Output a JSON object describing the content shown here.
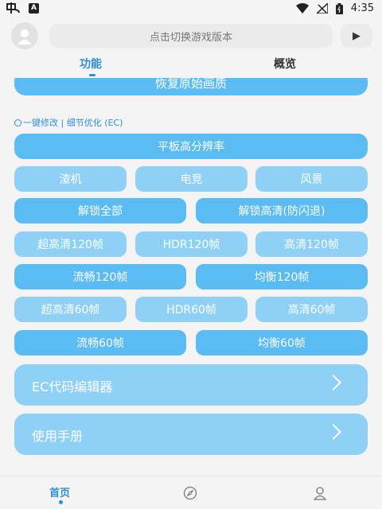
{
  "status": {
    "time": "4:35"
  },
  "header": {
    "search_text": "点击切换游戏版本"
  },
  "tabs": [
    {
      "label": "功能"
    },
    {
      "label": "概览"
    }
  ],
  "top_partial_button": "恢复原始画质",
  "section": {
    "label": "一键修改 | 细节优化 (EC)"
  },
  "buttons": {
    "tablet_resolution": "平板高分辨率",
    "low_end": "渣机",
    "esports": "电竞",
    "scenery": "风景",
    "unlock_all": "解锁全部",
    "unlock_hd": "解锁高清(防闪退)",
    "uhd_120": "超高清120帧",
    "hdr_120": "HDR120帧",
    "hd_120": "高清120帧",
    "smooth_120": "流畅120帧",
    "balanced_120": "均衡120帧",
    "uhd_60": "超高清60帧",
    "hdr_60": "HDR60帧",
    "hd_60": "高清60帧",
    "smooth_60": "流畅60帧",
    "balanced_60": "均衡60帧"
  },
  "cards": {
    "ec_editor": "EC代码编辑器",
    "manual": "使用手册"
  },
  "bottom_nav": {
    "home": "首页"
  },
  "colors": {
    "accent": "#2f8fd6",
    "button_dark": "#5bbcf4",
    "button_light": "#8fd1f6"
  }
}
